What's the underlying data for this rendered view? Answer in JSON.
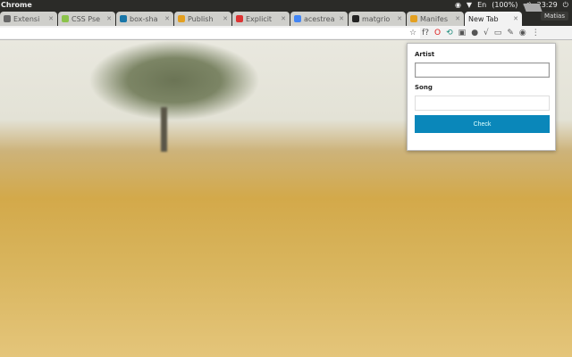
{
  "system": {
    "app_title": "Chrome",
    "battery": "(100%)",
    "keyboard": "En",
    "time": "23:29",
    "user": "Matias"
  },
  "tabs": [
    {
      "label": "Extensi",
      "color": "#666"
    },
    {
      "label": "CSS Pse",
      "color": "#8bc34a"
    },
    {
      "label": "box-sha",
      "color": "#1976a8"
    },
    {
      "label": "Publish",
      "color": "#e4a020"
    },
    {
      "label": "Explicit",
      "color": "#d33"
    },
    {
      "label": "acestrea",
      "color": "#4285f4"
    },
    {
      "label": "matgrio",
      "color": "#222"
    },
    {
      "label": "Manifes",
      "color": "#e4a020"
    },
    {
      "label": "New Tab",
      "color": "",
      "active": true
    }
  ],
  "toolbar": {
    "icons": [
      "star-icon",
      "font-icon",
      "opera-icon",
      "sync-icon",
      "extension-icon",
      "ext2-icon",
      "ext3-icon",
      "ext4-icon",
      "eyedropper-icon",
      "avatar-icon",
      "menu-icon"
    ],
    "glyphs": [
      "☆",
      "f?",
      "O",
      "⟲",
      "▣",
      "●",
      "√",
      "▭",
      "✎",
      "◉",
      "⋮"
    ]
  },
  "popup": {
    "artist_label": "Artist",
    "artist_value": "",
    "song_label": "Song",
    "song_value": "",
    "check_label": "Check"
  }
}
